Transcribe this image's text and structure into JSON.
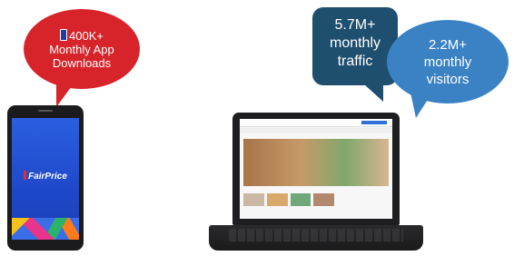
{
  "colors": {
    "red_bubble": "#d6242a",
    "navy_bubble": "#1e4f6f",
    "blue_bubble": "#3b82c4"
  },
  "bubbles": {
    "app_downloads": {
      "line1": "400K+",
      "line2": "Monthly App",
      "line3": "Downloads",
      "icon": "smartphone-icon"
    },
    "traffic": {
      "line1": "5.7M+",
      "line2": "monthly",
      "line3": "traffic"
    },
    "visitors": {
      "line1": "2.2M+",
      "line2": "monthly",
      "line3": "visitors"
    }
  },
  "phone": {
    "app_name": "FairPrice"
  }
}
